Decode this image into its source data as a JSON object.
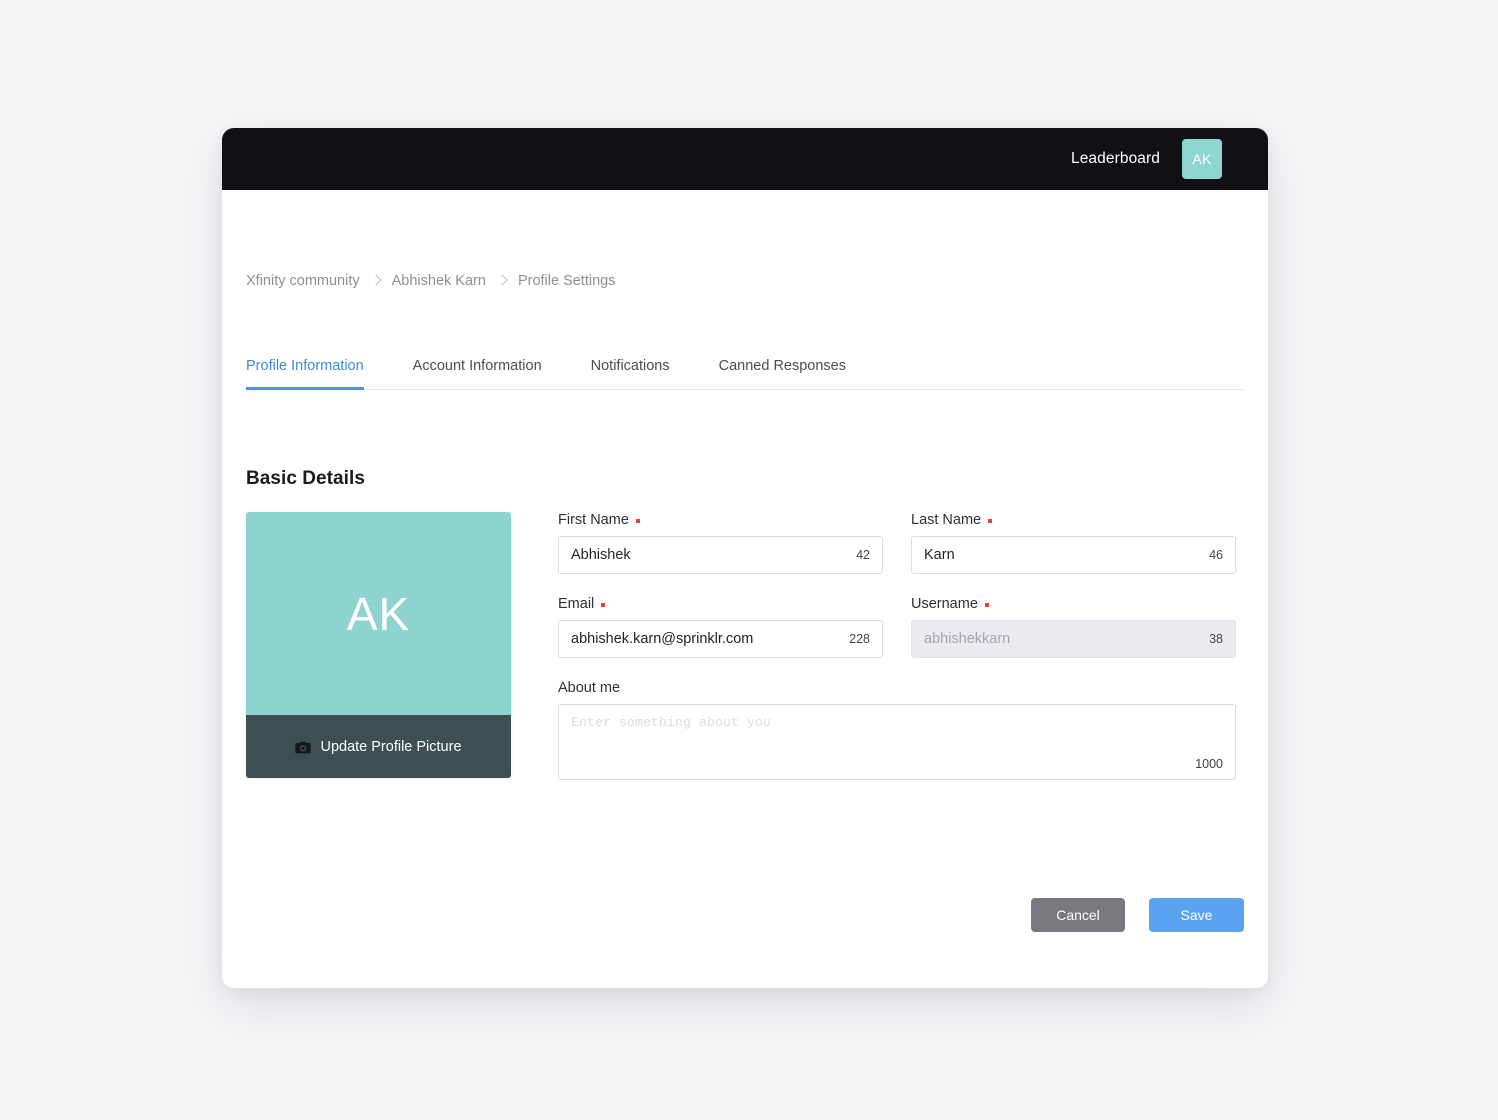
{
  "topbar": {
    "leaderboard_label": "Leaderboard",
    "avatar_initials": "AK"
  },
  "breadcrumb": {
    "items": [
      {
        "label": "Xfinity community"
      },
      {
        "label": "Abhishek Karn"
      },
      {
        "label": "Profile Settings"
      }
    ]
  },
  "tabs": [
    {
      "label": "Profile Information",
      "active": true
    },
    {
      "label": "Account Information",
      "active": false
    },
    {
      "label": "Notifications",
      "active": false
    },
    {
      "label": "Canned Responses",
      "active": false
    }
  ],
  "section": {
    "title": "Basic Details"
  },
  "avatar_card": {
    "initials": "AK",
    "update_label": "Update Profile Picture",
    "face_color": "#8dd4d1",
    "footer_color": "#3e4f52"
  },
  "form": {
    "first_name": {
      "label": "First Name",
      "required": true,
      "value": "Abhishek",
      "counter": "42"
    },
    "last_name": {
      "label": "Last Name",
      "required": true,
      "value": "Karn",
      "counter": "46"
    },
    "email": {
      "label": "Email",
      "required": true,
      "value": "abhishek.karn@sprinklr.com",
      "counter": "228"
    },
    "username": {
      "label": "Username",
      "required": true,
      "value": "abhishekkarn",
      "disabled": true,
      "counter": "38"
    },
    "about_me": {
      "label": "About me",
      "required": false,
      "placeholder": "Enter something about you",
      "value": "",
      "counter": "1000"
    }
  },
  "actions": {
    "cancel_label": "Cancel",
    "save_label": "Save",
    "cancel_color": "#78787e",
    "save_color": "#5aa3f0"
  }
}
